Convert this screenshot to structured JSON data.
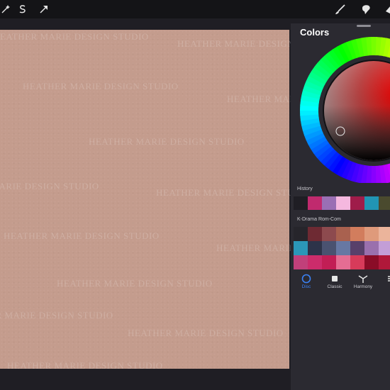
{
  "toolbar": {
    "left_icons": [
      "magic-wand-icon",
      "selection-s-icon",
      "transform-arrow-icon"
    ],
    "right_icons": [
      "brush-icon",
      "smudge-icon",
      "eraser-icon"
    ]
  },
  "canvas": {
    "background_color": "#c49c8d",
    "watermark_text": "HEATHER MARIE DESIGN STUDIO"
  },
  "colors_panel": {
    "title": "Colors",
    "history_label": "History",
    "history_swatches": [
      "#1f1e24",
      "#c02a6e",
      "#9a6fb4",
      "#f5b8df",
      "#9f1c4a",
      "#2195b4",
      "#4a4a2e"
    ],
    "palette_label": "K-Drama Rom-Com",
    "palette_rows": [
      [
        "#26252b",
        "#6e2a33",
        "#8d4a4e",
        "#a9614f",
        "#d27d5d",
        "#df9a7b",
        "#ebb49b"
      ],
      [
        "#2b97b8",
        "#2d3349",
        "#4a5270",
        "#6778a3",
        "#58406a",
        "#9a70ad",
        "#c39ed7"
      ],
      [
        "#c1407a",
        "#cc2c6b",
        "#c21e55",
        "#e56d93",
        "#d73b5a",
        "#8a0c27",
        "#b0183a"
      ]
    ],
    "tabs": [
      {
        "label": "Disc",
        "icon": "disc-icon",
        "active": true
      },
      {
        "label": "Classic",
        "icon": "classic-square-icon",
        "active": false
      },
      {
        "label": "Harmony",
        "icon": "harmony-icon",
        "active": false
      },
      {
        "label": "V",
        "icon": "value-sliders-icon",
        "active": false
      }
    ],
    "active_color": "#3b82f6"
  }
}
